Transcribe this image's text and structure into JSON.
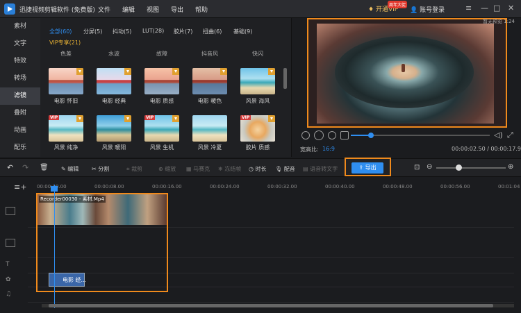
{
  "app": {
    "title": "迅捷视频剪辑软件 (免费版)"
  },
  "menu": [
    "文件",
    "编辑",
    "视图",
    "导出",
    "帮助"
  ],
  "header": {
    "vip_label": "开通VIP",
    "vip_badge": "周年大促",
    "login_label": "账号登录"
  },
  "sidebar": {
    "items": [
      "素材",
      "文字",
      "特效",
      "转场",
      "滤镜",
      "叠附",
      "动画",
      "配乐"
    ],
    "active_index": 4
  },
  "filters": {
    "categories": [
      "全部(60)",
      "分屏(5)",
      "抖动(5)",
      "LUT(28)",
      "胶片(7)",
      "扭曲(6)",
      "基础(9)"
    ],
    "vip_category": "VIP专享(21)",
    "subcategories": [
      "色差",
      "水波",
      "故障",
      "抖音风",
      "快闪"
    ],
    "items": [
      "电影 怀旧",
      "电影 经典",
      "电影 质感",
      "电影 暖色",
      "风景 海风",
      "风景 纯净",
      "风景 暖阳",
      "风景 生机",
      "风景 冷夏",
      "胶片 质感"
    ],
    "vip_tag": "VIP"
  },
  "preview": {
    "time_overlay": "暂无预览 1:24",
    "aspect_label": "宽高比:",
    "aspect_value": "16:9",
    "timecode": "00:00:02.50 / 00:00:17.98",
    "progress_fraction": 0.14
  },
  "toolbar": {
    "edit": "编辑",
    "split": "分割",
    "crop": "裁剪",
    "zoom": "缩放",
    "marquee": "马赛克",
    "freeze": "冻结帧",
    "duration": "时长",
    "dub": "配音",
    "speech": "语音转文字",
    "export": "导出"
  },
  "timeline": {
    "ticks": [
      "00:00:00.00",
      "00:00:08.00",
      "00:00:16.00",
      "00:00:24.00",
      "00:00:32.00",
      "00:00:40.00",
      "00:00:48.00",
      "00:00:56.00",
      "00:01:04"
    ],
    "clip_name": "Recorder00030 - 素材.Mp4",
    "filter_clip": "电影 经..."
  },
  "colors": {
    "accent": "#2f8ef0",
    "highlight": "#f08a1c",
    "vip": "#e8b234"
  }
}
